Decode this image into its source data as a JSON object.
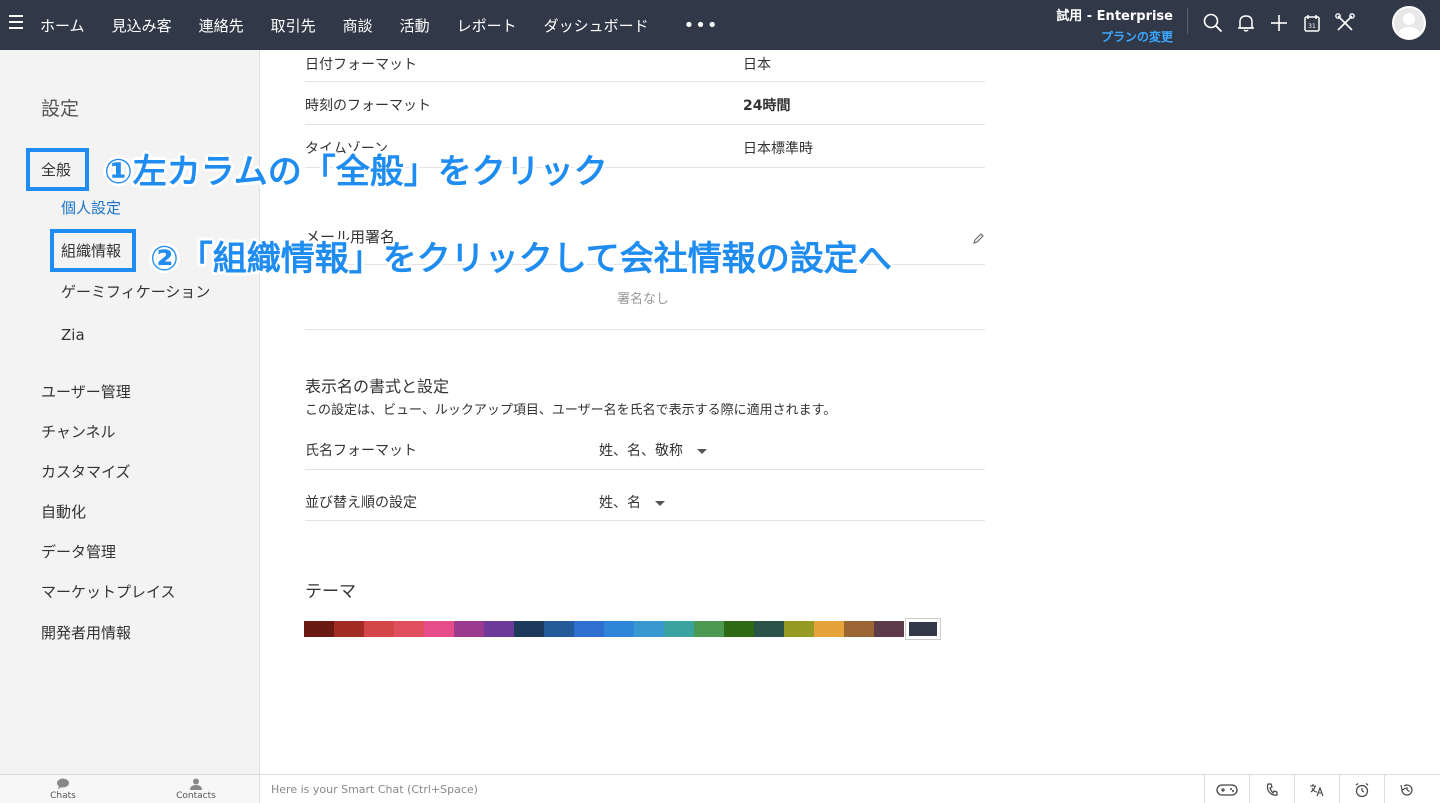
{
  "topbar": {
    "nav": [
      "ホーム",
      "見込み客",
      "連絡先",
      "取引先",
      "商談",
      "活動",
      "レポート",
      "ダッシュボード"
    ],
    "more": "•••",
    "plan_label": "試用 - Enterprise",
    "plan_change": "プランの変更",
    "icons": [
      "search-icon",
      "bell-icon",
      "plus-icon",
      "calendar-icon",
      "tools-icon"
    ]
  },
  "sidebar": {
    "title": "設定",
    "general": "全般",
    "personal": "個人設定",
    "org": "組織情報",
    "gamification": "ゲーミフィケーション",
    "zia": "Zia",
    "items": [
      "ユーザー管理",
      "チャンネル",
      "カスタマイズ",
      "自動化",
      "データ管理",
      "マーケットプレイス",
      "開発者用情報"
    ]
  },
  "settings": {
    "rows": [
      {
        "label": "日付フォーマット",
        "value": "日本"
      },
      {
        "label": "時刻のフォーマット",
        "value": "24時間"
      },
      {
        "label": "タイムゾーン",
        "value": "日本標準時"
      }
    ],
    "signature_title": "メール用署名",
    "signature_empty": "署名なし",
    "display_title": "表示名の書式と設定",
    "display_desc": "この設定は、ビュー、ルックアップ項目、ユーザー名を氏名で表示する際に適用されます。",
    "name_format_label": "氏名フォーマット",
    "name_format_value": "姓、名、敬称",
    "sort_label": "並び替え順の設定",
    "sort_value": "姓、名",
    "theme_title": "テーマ",
    "theme_colors": [
      "#6b1a12",
      "#a22b24",
      "#d44748",
      "#e0505e",
      "#e64b8b",
      "#9b3a8f",
      "#6e3a9a",
      "#1b3a5c",
      "#235a9a",
      "#2e6fd0",
      "#2f86d8",
      "#3798cf",
      "#3ba39f",
      "#4c9a52",
      "#2d6a13",
      "#2a544a",
      "#959a22",
      "#e6a33c",
      "#9c6534",
      "#5e3b4a",
      "#313949"
    ]
  },
  "annotations": {
    "step1": "①左カラムの「全般」をクリック",
    "step2": "②「組織情報」をクリックして会社情報の設定へ"
  },
  "bottombar": {
    "chats": "Chats",
    "contacts": "Contacts",
    "smart_chat": "Here is your Smart Chat (Ctrl+Space)",
    "right_icons": [
      "gamepad-icon",
      "phone-icon",
      "translate-icon",
      "alarm-icon",
      "history-icon"
    ]
  }
}
